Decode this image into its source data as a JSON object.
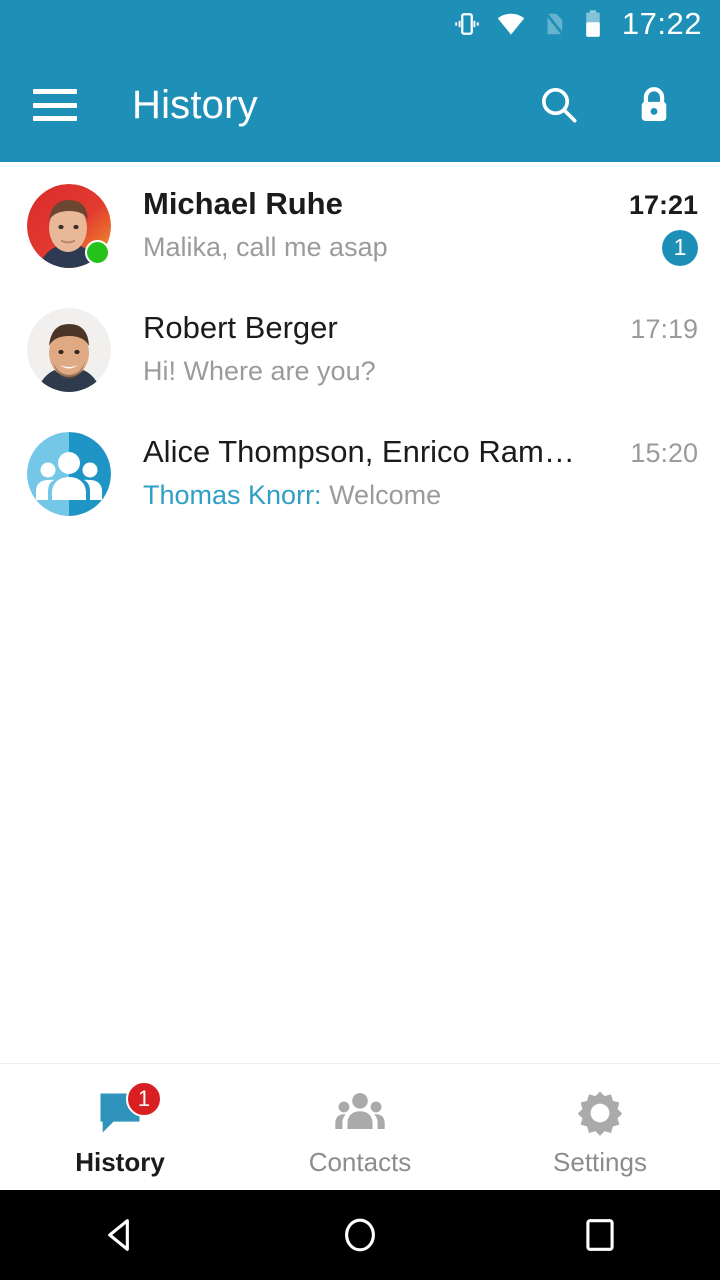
{
  "status_bar": {
    "time": "17:22",
    "icons": [
      "vibrate-icon",
      "wifi-icon",
      "no-sim-icon",
      "battery-icon"
    ]
  },
  "app_bar": {
    "title": "History",
    "menu_icon": "hamburger-menu-icon",
    "actions": [
      {
        "name": "search-icon",
        "label": "Search"
      },
      {
        "name": "lock-icon",
        "label": "Lock"
      }
    ]
  },
  "colors": {
    "primary": "#1e90b8",
    "accent_link": "#2f9fc4",
    "badge_unread": "#1e90b8",
    "badge_alert": "#d81f21",
    "online": "#24c21a",
    "text_primary": "#1b1b1b",
    "text_secondary": "#9b9b9b",
    "navbar": "#000000"
  },
  "conversations": [
    {
      "name": "Michael Ruhe",
      "snippet": "Malika, call me asap",
      "sender_prefix": "",
      "time": "17:21",
      "unread_count": "1",
      "unread": true,
      "avatar_type": "photo",
      "online": true
    },
    {
      "name": "Robert Berger",
      "snippet": "Hi! Where are you?",
      "sender_prefix": "",
      "time": "17:19",
      "unread_count": "",
      "unread": false,
      "avatar_type": "photo",
      "online": false
    },
    {
      "name": "Alice Thompson, Enrico Ram…",
      "snippet": "Welcome",
      "sender_prefix": "Thomas Knorr: ",
      "time": "15:20",
      "unread_count": "",
      "unread": false,
      "avatar_type": "group",
      "online": false
    }
  ],
  "tab_bar": {
    "tabs": [
      {
        "label": "History",
        "icon": "chat-bubble-icon",
        "badge": "1",
        "active": true
      },
      {
        "label": "Contacts",
        "icon": "contacts-group-icon",
        "badge": "",
        "active": false
      },
      {
        "label": "Settings",
        "icon": "gear-icon",
        "badge": "",
        "active": false
      }
    ]
  },
  "nav_bar": {
    "buttons": [
      {
        "name": "back-button",
        "icon": "triangle-back-icon"
      },
      {
        "name": "home-button",
        "icon": "circle-home-icon"
      },
      {
        "name": "recents-button",
        "icon": "square-recents-icon"
      }
    ]
  }
}
